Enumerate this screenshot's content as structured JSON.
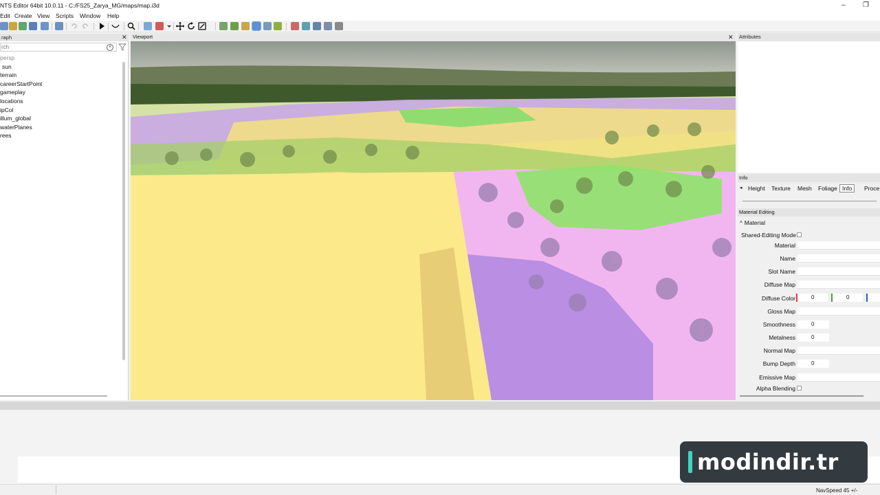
{
  "window": {
    "title": "NTS Editor 64bit 10.0.11 - C:/FS25_Zarya_MG/maps/map.i3d",
    "minimize_glyph": "–",
    "maximize_glyph": "❐"
  },
  "menubar": {
    "items": [
      "Edit",
      "Create",
      "View",
      "Scripts",
      "Window",
      "Help"
    ]
  },
  "scenegraph": {
    "title": "raph",
    "close_glyph": "✕",
    "search_placeholder": "rch",
    "clear_glyph": "×",
    "items": [
      "persp",
      "sun",
      "terrain",
      "careerStartPoint",
      "gameplay",
      "locations",
      "ipCol",
      "illum_global",
      "waterPlanes",
      "rees"
    ]
  },
  "viewport": {
    "title": "Viewport",
    "close_glyph": "✕"
  },
  "attributes": {
    "title": "Attributes"
  },
  "info": {
    "title": "Info",
    "tabs": [
      "Height",
      "Texture",
      "Mesh",
      "Foliage",
      "Info",
      "Proce"
    ],
    "active_tab": "Info"
  },
  "material_editing": {
    "title": "Material Editing",
    "group_label": "Material",
    "group_glyph": "^",
    "shared_editing_label": "Shared-Editing Mode",
    "properties": {
      "material": "Material",
      "name": "Name",
      "slot_name": "Slot Name",
      "diffuse_map": "Diffuse Map",
      "diffuse_color": "Diffuse Color",
      "gloss_map": "Gloss Map",
      "smoothness": "Smoothness",
      "metalness": "Metalness",
      "normal_map": "Normal Map",
      "bump_depth": "Bump Depth",
      "emissive_map": "Emissive Map",
      "alpha_blending": "Alpha Blending"
    },
    "values": {
      "diffuse_r": "0",
      "diffuse_g": "0",
      "smoothness": "0",
      "metalness": "0",
      "bump_depth": "0"
    },
    "channel_colors": {
      "r": "#e53935",
      "g": "#43a047",
      "b": "#1e63c7"
    }
  },
  "statusbar": {
    "nav_speed": "NavSpeed 45 +/-"
  },
  "watermark": {
    "text": "modindir.tr"
  },
  "colors": {
    "accent_teal": "#3fd5c3",
    "overlay_yellow": "#fbe98a",
    "overlay_purple": "#b98ee3",
    "overlay_pink": "#f1b6f0",
    "overlay_green": "#8ee36a"
  }
}
